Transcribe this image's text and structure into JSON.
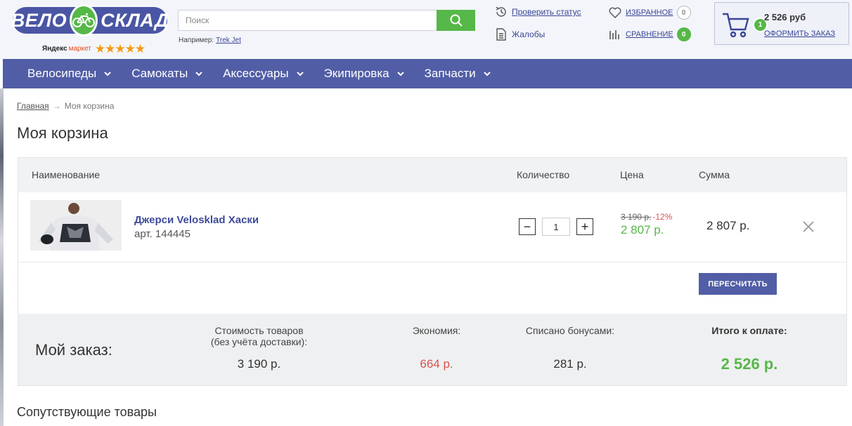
{
  "header": {
    "logo_left": "ВЕЛО",
    "logo_right": "СКЛАД",
    "ym_yandex": "Яндекс",
    "ym_market": "маркет",
    "ym_stars": "★★★★★",
    "search_placeholder": "Поиск",
    "example_label": "Например:",
    "example_link": "Trek Jet",
    "check_status": "Проверить статус",
    "complaints": "Жалобы",
    "favorites": "Избранное",
    "favorites_count": "0",
    "compare": "Сравнение",
    "compare_count": "0",
    "cart_count": "1",
    "cart_total": "2 526 руб",
    "checkout": "Оформить заказ"
  },
  "nav": {
    "items": [
      {
        "label": "Велосипеды"
      },
      {
        "label": "Самокаты"
      },
      {
        "label": "Аксессуары"
      },
      {
        "label": "Экипировка"
      },
      {
        "label": "Запчасти"
      }
    ]
  },
  "breadcrumb": {
    "home": "Главная",
    "arrow": "→",
    "current": "Моя корзина"
  },
  "page_title": "Моя корзина",
  "cart_table": {
    "columns": {
      "name": "Наименование",
      "qty": "Количество",
      "price": "Цена",
      "sum": "Сумма"
    },
    "items": [
      {
        "name": "Джерси Velosklad Хаски",
        "article": "арт. 144445",
        "qty": "1",
        "qty_minus": "−",
        "qty_plus": "+",
        "old_price": "3 190 р.",
        "discount": "-12%",
        "price": "2 807 р.",
        "sum": "2 807 р."
      }
    ],
    "recalc": "Пересчитать"
  },
  "order_summary": {
    "title": "Мой заказ:",
    "goods_label_1": "Стоимость товаров",
    "goods_label_2": "(без учёта доставки):",
    "goods_value": "3 190 р.",
    "savings_label": "Экономия:",
    "savings_value": "664 р.",
    "bonus_label": "Списано бонусами:",
    "bonus_value": "281 р.",
    "total_label": "Итого к оплате:",
    "total_value": "2 526 р."
  },
  "related_title": "Сопутствующие товары",
  "colors": {
    "brand_blue": "#515ea6",
    "brand_green": "#56b848",
    "discount_red": "#d9534f"
  }
}
